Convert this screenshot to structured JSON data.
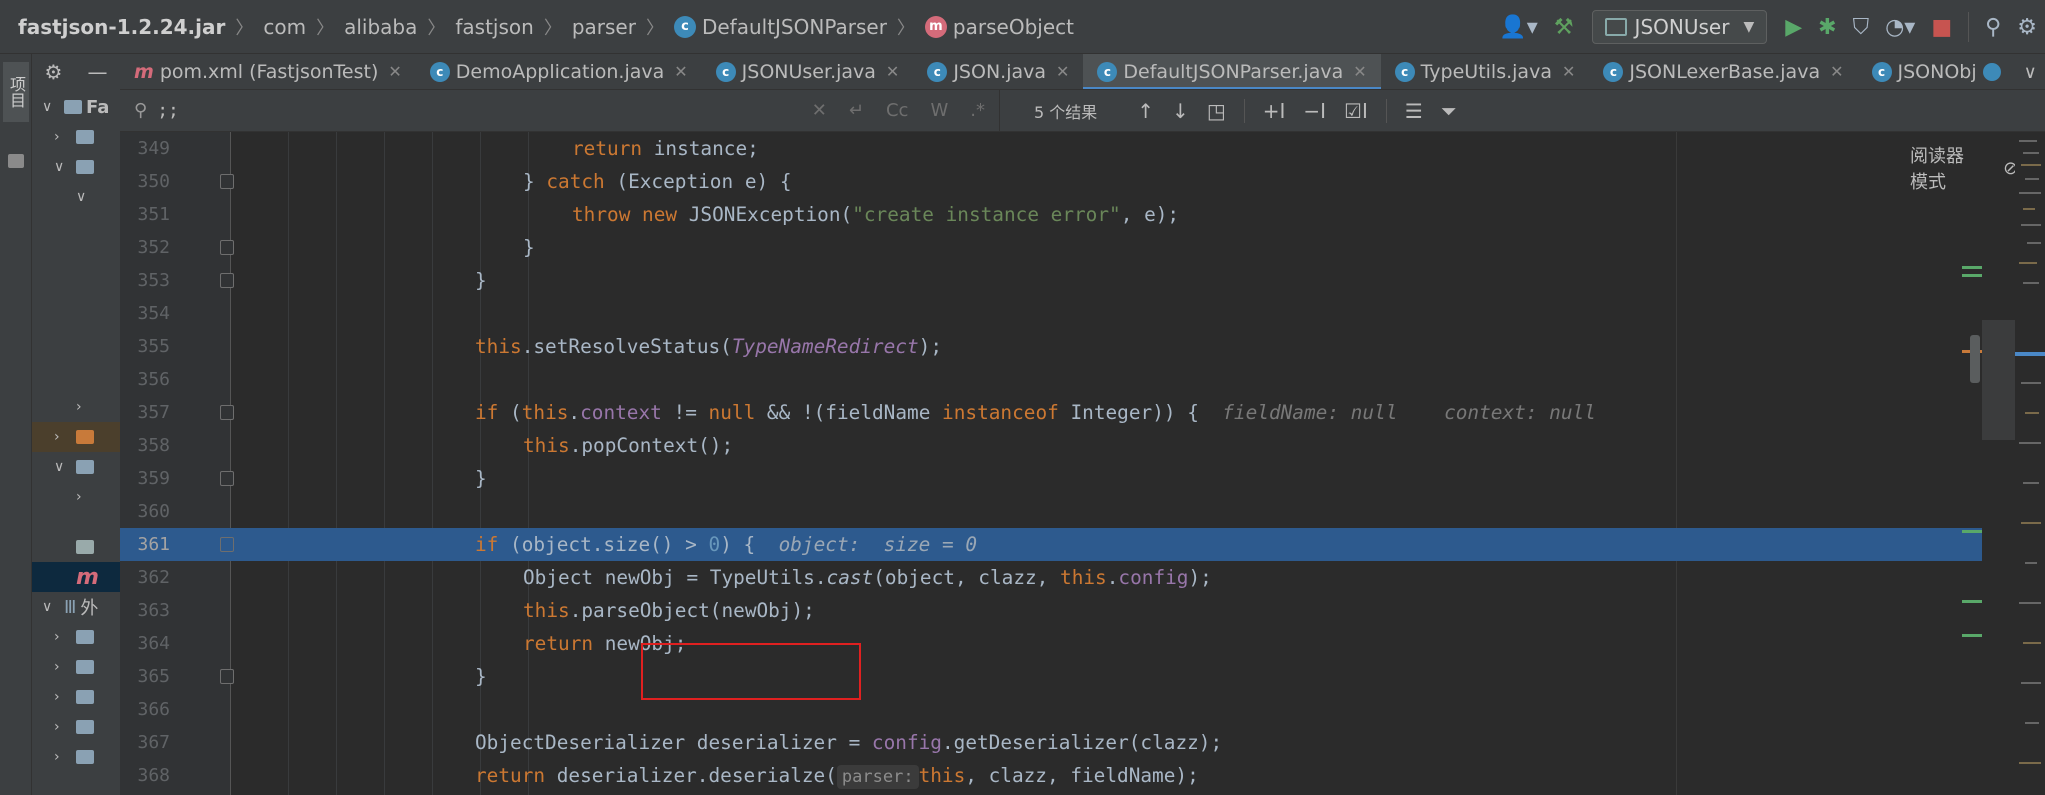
{
  "breadcrumb": {
    "items": [
      "fastjson-1.2.24.jar",
      "com",
      "alibaba",
      "fastjson",
      "parser",
      "DefaultJSONParser",
      "parseObject"
    ]
  },
  "toolbar": {
    "run_config": "JSONUser"
  },
  "side_tab": {
    "label": "项目"
  },
  "project": {
    "header": "Fa",
    "row_ext": "外"
  },
  "tabs": [
    {
      "label": "pom.xml (FastjsonTest)",
      "icon": "maven-icon"
    },
    {
      "label": "DemoApplication.java",
      "icon": "class-icon"
    },
    {
      "label": "JSONUser.java",
      "icon": "class-icon"
    },
    {
      "label": "JSON.java",
      "icon": "class-icon"
    },
    {
      "label": "DefaultJSONParser.java",
      "icon": "class-icon",
      "active": true
    },
    {
      "label": "TypeUtils.java",
      "icon": "class-icon"
    },
    {
      "label": "JSONLexerBase.java",
      "icon": "class-icon"
    },
    {
      "label": "JSONObject.java",
      "icon": "class-icon"
    }
  ],
  "search": {
    "value": ";;",
    "results": "5 个结果",
    "opt_case": "Cc",
    "opt_word": "W",
    "opt_regex": ".*"
  },
  "editor": {
    "reader_mode": "阅读器模式",
    "lines": [
      {
        "n": "349"
      },
      {
        "n": "350"
      },
      {
        "n": "351"
      },
      {
        "n": "352"
      },
      {
        "n": "353"
      },
      {
        "n": "354"
      },
      {
        "n": "355"
      },
      {
        "n": "356"
      },
      {
        "n": "357"
      },
      {
        "n": "358"
      },
      {
        "n": "359"
      },
      {
        "n": "360"
      },
      {
        "n": "361"
      },
      {
        "n": "362"
      },
      {
        "n": "363"
      },
      {
        "n": "364"
      },
      {
        "n": "365"
      },
      {
        "n": "366"
      },
      {
        "n": "367"
      },
      {
        "n": "368"
      }
    ],
    "tokens": {
      "l349_a": "return",
      "l349_b": " instance;",
      "l350_a": "} ",
      "l350_b": "catch",
      "l350_c": " (Exception e) {",
      "l351_a": "throw new",
      "l351_b": " JSONException(",
      "l351_c": "\"create instance error\"",
      "l351_d": ", e);",
      "l352_a": "}",
      "l353_a": "}",
      "l355_a": "this",
      "l355_b": ".setResolveStatus(",
      "l355_c": "TypeNameRedirect",
      "l355_d": ");",
      "l357_a": "if",
      "l357_b": " (",
      "l357_c": "this",
      "l357_d": ".",
      "l357_e": "context",
      "l357_f": " != ",
      "l357_g": "null",
      "l357_h": " && !(fieldName ",
      "l357_i": "instanceof",
      "l357_j": " Integer)) {",
      "l357_hint1": "fieldName: null",
      "l357_hint2": "context: null",
      "l358_a": "this",
      "l358_b": ".popContext();",
      "l359_a": "}",
      "l361_a": "if",
      "l361_b": " (object.size() > ",
      "l361_c": "0",
      "l361_d": ") {",
      "l361_hint": "object:  size = 0",
      "l362_a": "Object newObj = TypeUtils.",
      "l362_b": "cast",
      "l362_c": "(object, clazz, ",
      "l362_d": "this",
      "l362_e": ".",
      "l362_f": "config",
      "l362_g": ");",
      "l363_a": "this",
      "l363_b": ".parseObject(newObj);",
      "l364_a": "return",
      "l364_b": " newObj;",
      "l365_a": "}",
      "l367_a": "ObjectDeserializer deserializer = ",
      "l367_b": "config",
      "l367_c": ".getDeserializer(clazz);",
      "l368_a": "return",
      "l368_b": " deserializer.deserialze(",
      "l368_hint": "parser:",
      "l368_c": "this",
      "l368_d": ", clazz, fieldName);"
    }
  },
  "colors": {
    "background": "#2b2b2b",
    "keyword": "#cc7832",
    "string": "#6a8759",
    "field": "#9876aa",
    "number": "#6897bb",
    "selection": "#2d5a8e",
    "annotation_box": "#e02020"
  }
}
